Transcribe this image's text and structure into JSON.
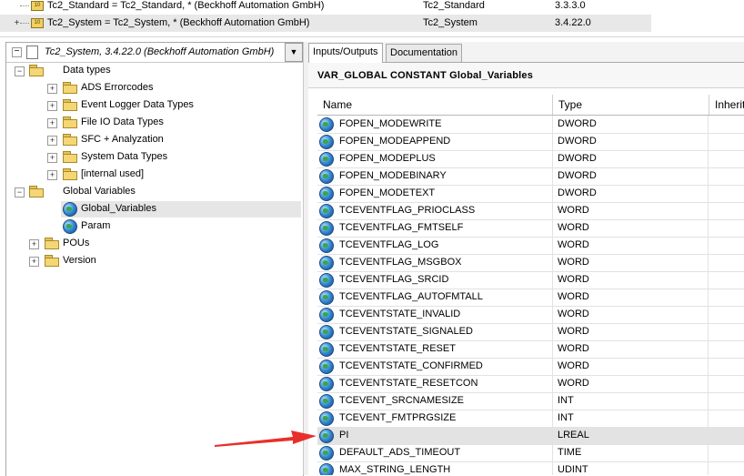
{
  "libraries": [
    {
      "name": "Tc2_Standard = Tc2_Standard, * (Beckhoff Automation GmbH)",
      "namespace": "Tc2_Standard",
      "version": "3.3.3.0"
    },
    {
      "name": "Tc2_System = Tc2_System, * (Beckhoff Automation GmbH)",
      "namespace": "Tc2_System",
      "version": "3.4.22.0"
    }
  ],
  "tree": {
    "root": "Tc2_System, 3.4.22.0 (Beckhoff Automation GmbH)",
    "data_types": "Data types",
    "data_type_children": [
      "ADS Errorcodes",
      "Event Logger Data Types",
      "File IO Data Types",
      "SFC + Analyzation",
      "System Data Types",
      "[internal used]"
    ],
    "global_variables": "Global Variables",
    "global_children": [
      "Global_Variables",
      "Param"
    ],
    "pous": "POUs",
    "version": "Version"
  },
  "tabs": [
    "Inputs/Outputs",
    "Documentation"
  ],
  "header_title": "VAR_GLOBAL CONSTANT  Global_Variables",
  "columns": {
    "name": "Name",
    "type": "Type",
    "inherited": "Inherit"
  },
  "rows": [
    {
      "name": "FOPEN_MODEWRITE",
      "type": "DWORD"
    },
    {
      "name": "FOPEN_MODEAPPEND",
      "type": "DWORD"
    },
    {
      "name": "FOPEN_MODEPLUS",
      "type": "DWORD"
    },
    {
      "name": "FOPEN_MODEBINARY",
      "type": "DWORD"
    },
    {
      "name": "FOPEN_MODETEXT",
      "type": "DWORD"
    },
    {
      "name": "TCEVENTFLAG_PRIOCLASS",
      "type": "WORD"
    },
    {
      "name": "TCEVENTFLAG_FMTSELF",
      "type": "WORD"
    },
    {
      "name": "TCEVENTFLAG_LOG",
      "type": "WORD"
    },
    {
      "name": "TCEVENTFLAG_MSGBOX",
      "type": "WORD"
    },
    {
      "name": "TCEVENTFLAG_SRCID",
      "type": "WORD"
    },
    {
      "name": "TCEVENTFLAG_AUTOFMTALL",
      "type": "WORD"
    },
    {
      "name": "TCEVENTSTATE_INVALID",
      "type": "WORD"
    },
    {
      "name": "TCEVENTSTATE_SIGNALED",
      "type": "WORD"
    },
    {
      "name": "TCEVENTSTATE_RESET",
      "type": "WORD"
    },
    {
      "name": "TCEVENTSTATE_CONFIRMED",
      "type": "WORD"
    },
    {
      "name": "TCEVENTSTATE_RESETCON",
      "type": "WORD"
    },
    {
      "name": "TCEVENT_SRCNAMESIZE",
      "type": "INT"
    },
    {
      "name": "TCEVENT_FMTPRGSIZE",
      "type": "INT"
    },
    {
      "name": "PI",
      "type": "LREAL"
    },
    {
      "name": "DEFAULT_ADS_TIMEOUT",
      "type": "TIME"
    },
    {
      "name": "MAX_STRING_LENGTH",
      "type": "UDINT"
    }
  ],
  "colors": {
    "arrow": "#e8302a",
    "selection": "#e3e3e3",
    "folder": "#f4d675"
  }
}
